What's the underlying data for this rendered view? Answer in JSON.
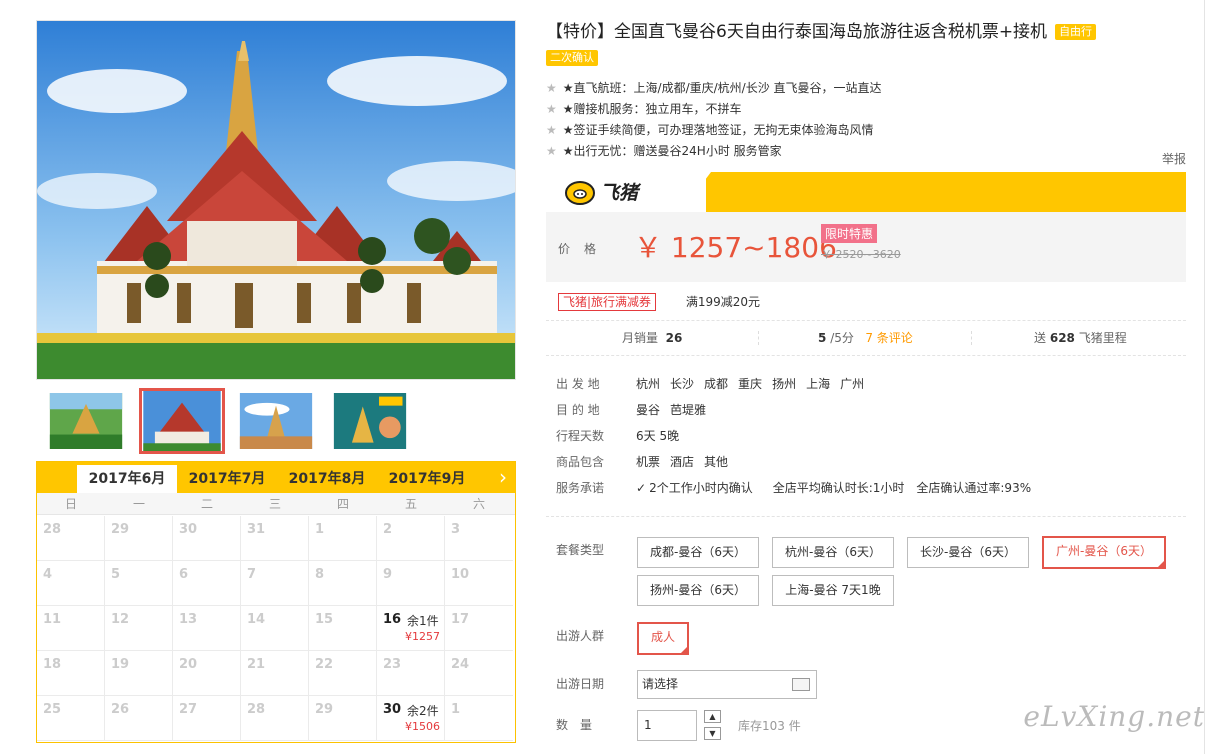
{
  "product": {
    "title": "【特价】全国直飞曼谷6天自由行泰国海岛旅游往返含税机票+接机",
    "type_badge": "自由行",
    "confirm_badge": "二次确认",
    "highlights": [
      "★直飞航班：上海/成都/重庆/杭州/长沙 直飞曼谷，一站直达",
      "★赠接机服务：独立用车，不拼车",
      "★签证手续简便，可办理落地签证，无拘无束体验海岛风情",
      "★出行无忧：赠送曼谷24H小时 服务管家"
    ],
    "report": "举报"
  },
  "brand": {
    "name": "飞猪"
  },
  "price": {
    "label": "价格",
    "value": "￥ 1257~1806",
    "tag": "限时特惠",
    "original": "￥ 2520~3620"
  },
  "coupon": {
    "badge": "飞猪|旅行满减券",
    "text": "满199减20元"
  },
  "stats": {
    "monthly_label": "月销量",
    "monthly_value": "26",
    "score": "5",
    "score_suffix": "/5分",
    "reviews": "7 条评论",
    "miles_prefix": "送",
    "miles_value": "628",
    "miles_suffix": "飞猪里程"
  },
  "info": {
    "departure_label": "出 发 地",
    "departures": [
      "杭州",
      "长沙",
      "成都",
      "重庆",
      "扬州",
      "上海",
      "广州"
    ],
    "destination_label": "目 的 地",
    "destinations": [
      "曼谷",
      "芭堤雅"
    ],
    "days_label": "行程天数",
    "days_value": "6天 5晚",
    "includes_label": "商品包含",
    "includes": [
      "机票",
      "酒店",
      "其他"
    ],
    "service_label": "服务承诺",
    "service_value": "2个工作小时内确认",
    "service_avg": "全店平均确认时长:1小时",
    "service_rate": "全店确认通过率:93%"
  },
  "options": {
    "package_label": "套餐类型",
    "packages": [
      "成都-曼谷（6天）",
      "杭州-曼谷（6天）",
      "长沙-曼谷（6天）",
      "广州-曼谷（6天）",
      "扬州-曼谷（6天）",
      "上海-曼谷 7天1晚"
    ],
    "selected_package": "广州-曼谷（6天）",
    "traveler_label": "出游人群",
    "traveler": "成人",
    "date_label": "出游日期",
    "date_placeholder": "请选择",
    "qty_label": "数　量",
    "qty_value": "1",
    "stock": "库存103 件"
  },
  "calendar": {
    "months": [
      "2017年6月",
      "2017年7月",
      "2017年8月",
      "2017年9月"
    ],
    "active_month": "2017年6月",
    "weekdays": [
      "日",
      "一",
      "二",
      "三",
      "四",
      "五",
      "六"
    ],
    "weeks": [
      [
        {
          "d": "28"
        },
        {
          "d": "29"
        },
        {
          "d": "30"
        },
        {
          "d": "31"
        },
        {
          "d": "1"
        },
        {
          "d": "2"
        },
        {
          "d": "3"
        }
      ],
      [
        {
          "d": "4"
        },
        {
          "d": "5"
        },
        {
          "d": "6"
        },
        {
          "d": "7"
        },
        {
          "d": "8"
        },
        {
          "d": "9"
        },
        {
          "d": "10"
        }
      ],
      [
        {
          "d": "11"
        },
        {
          "d": "12"
        },
        {
          "d": "13"
        },
        {
          "d": "14"
        },
        {
          "d": "15"
        },
        {
          "d": "16",
          "stock": "余1件",
          "price": "¥1257"
        },
        {
          "d": "17"
        }
      ],
      [
        {
          "d": "18"
        },
        {
          "d": "19"
        },
        {
          "d": "20"
        },
        {
          "d": "21"
        },
        {
          "d": "22"
        },
        {
          "d": "23"
        },
        {
          "d": "24"
        }
      ],
      [
        {
          "d": "25"
        },
        {
          "d": "26"
        },
        {
          "d": "27"
        },
        {
          "d": "28"
        },
        {
          "d": "29"
        },
        {
          "d": "30",
          "stock": "余2件",
          "price": "¥1506"
        },
        {
          "d": "1"
        }
      ]
    ]
  },
  "thumbs": [
    "thumb-promo-bangkok",
    "thumb-grand-palace",
    "thumb-pagoda-sky",
    "thumb-promo-temple"
  ],
  "watermark": "eLvXing.net"
}
